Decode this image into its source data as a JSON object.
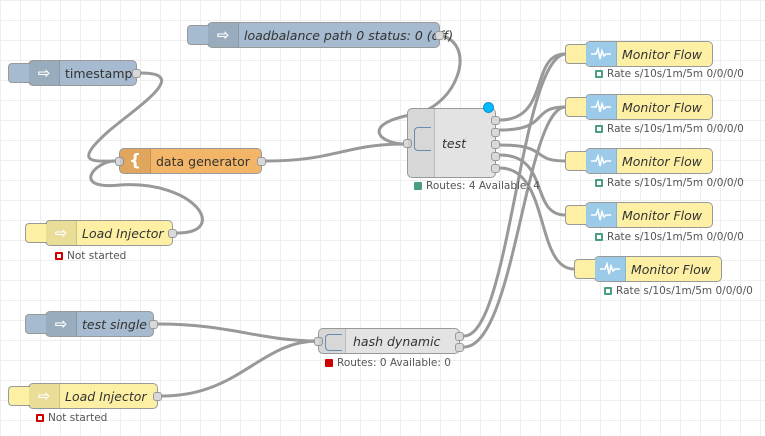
{
  "nodes": {
    "loadbalance_status": {
      "label": "loadbalance path 0 status: 0 (off)",
      "icon": "arrow-right-icon",
      "color": "#a6bbcf"
    },
    "timestamp": {
      "label": "timestamp",
      "icon": "arrow-right-icon",
      "color": "#a6bbcf"
    },
    "data_generator": {
      "label": "data generator",
      "icon": "curly-brace-icon",
      "color": "#f3b567"
    },
    "load_injector_1": {
      "label": "Load Injector",
      "icon": "arrow-right-icon",
      "color": "#fdf0a5",
      "status": "Not started",
      "status_color": "#cc0000"
    },
    "test": {
      "label": "test",
      "icon": "load-balance-icon",
      "color": "#e3e3e3",
      "status": "Routes: 4 Available: 4",
      "status_color": "#4a9f83"
    },
    "test_single": {
      "label": "test single",
      "icon": "arrow-right-icon",
      "color": "#a6bbcf"
    },
    "hash_dynamic": {
      "label": "hash dynamic",
      "icon": "load-balance-icon",
      "color": "#e3e3e3",
      "status": "Routes: 0 Available: 0",
      "status_color": "#cc0000"
    },
    "load_injector_2": {
      "label": "Load Injector",
      "icon": "arrow-right-icon",
      "color": "#fdf0a5",
      "status": "Not started",
      "status_color": "#cc0000"
    },
    "monitor_flows": [
      {
        "label": "Monitor Flow",
        "icon": "waveform-icon",
        "color": "#fdf0a5",
        "status": "Rate s/10s/1m/5m 0/0/0/0",
        "status_color": "#4a9f83"
      },
      {
        "label": "Monitor Flow",
        "icon": "waveform-icon",
        "color": "#fdf0a5",
        "status": "Rate s/10s/1m/5m 0/0/0/0",
        "status_color": "#4a9f83"
      },
      {
        "label": "Monitor Flow",
        "icon": "waveform-icon",
        "color": "#fdf0a5",
        "status": "Rate s/10s/1m/5m 0/0/0/0",
        "status_color": "#4a9f83"
      },
      {
        "label": "Monitor Flow",
        "icon": "waveform-icon",
        "color": "#fdf0a5",
        "status": "Rate s/10s/1m/5m 0/0/0/0",
        "status_color": "#4a9f83"
      },
      {
        "label": "Monitor Flow",
        "icon": "waveform-icon",
        "color": "#fdf0a5",
        "status": "Rate s/10s/1m/5m 0/0/0/0",
        "status_color": "#4a9f83"
      }
    ]
  },
  "colors": {
    "wire": "#999999",
    "changed_indicator": "#00bcff",
    "monitor_icon_bg": "#9ccbea"
  }
}
